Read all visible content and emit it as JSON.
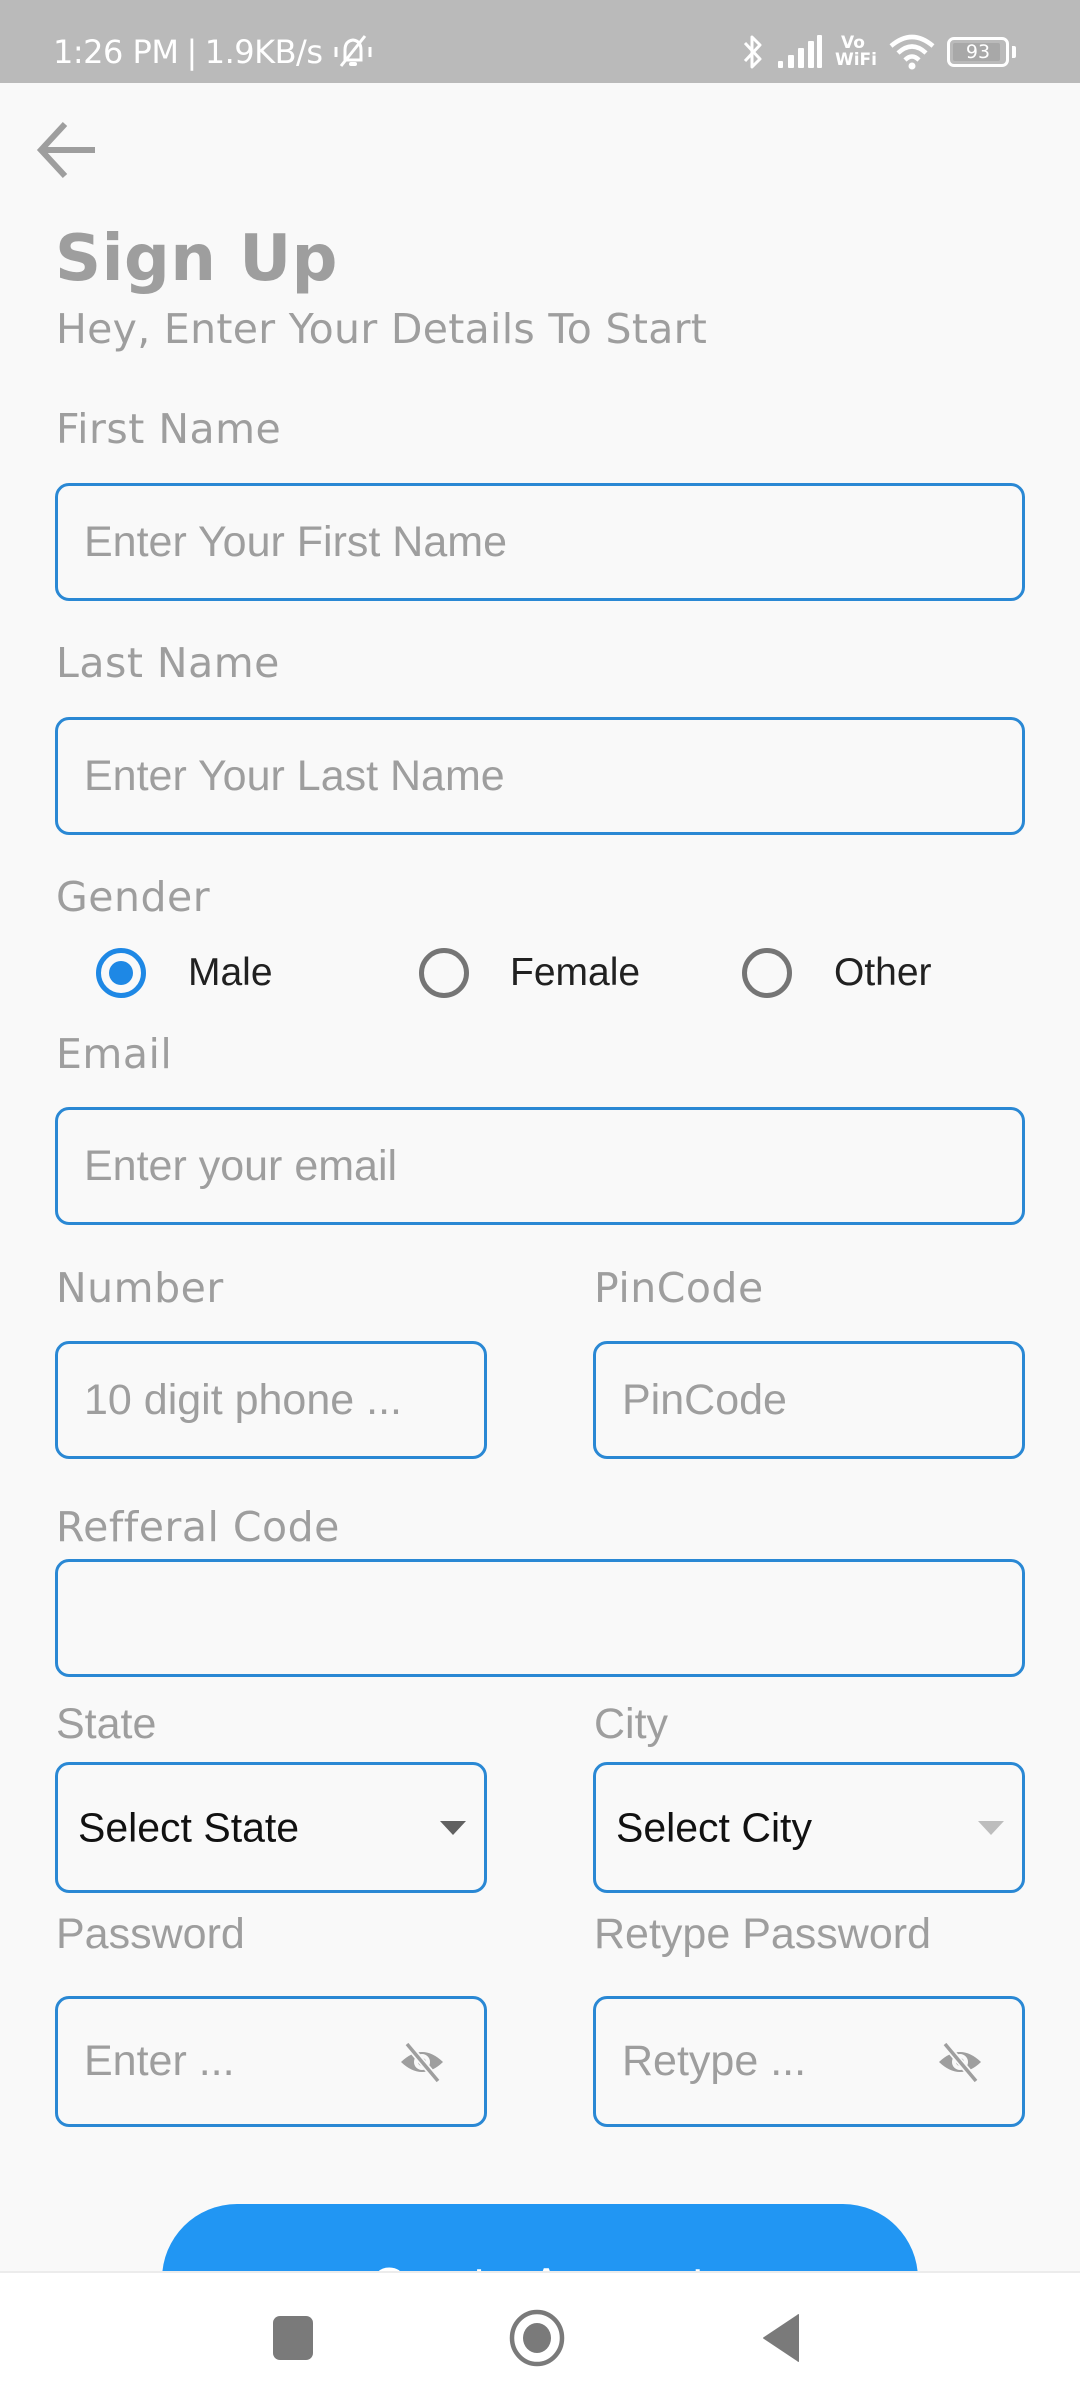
{
  "status_bar": {
    "time": "1:26 PM",
    "separator": "|",
    "network_speed": "1.9KB/s",
    "icons": [
      "bell-off-icon",
      "bluetooth-icon",
      "signal-icon",
      "vowifi-icon",
      "wifi-icon",
      "battery-icon"
    ],
    "vowifi_top": "Vo",
    "vowifi_bottom": "WiFi",
    "battery_level": "93"
  },
  "header": {
    "back_icon": "arrow-left-icon",
    "title": "Sign Up",
    "subtitle": "Hey, Enter Your Details To Start"
  },
  "form": {
    "first_name": {
      "label": "First Name",
      "placeholder": "Enter Your First Name",
      "value": ""
    },
    "last_name": {
      "label": "Last Name",
      "placeholder": "Enter Your Last Name",
      "value": ""
    },
    "gender": {
      "label": "Gender",
      "options": [
        "Male",
        "Female",
        "Other"
      ],
      "selected": "Male"
    },
    "email": {
      "label": "Email",
      "placeholder": "Enter your email",
      "value": ""
    },
    "number": {
      "label": "Number",
      "placeholder": "10 digit phone ...",
      "value": ""
    },
    "pincode": {
      "label": "PinCode",
      "placeholder": "PinCode",
      "value": ""
    },
    "referral_code": {
      "label": "Refferal Code",
      "placeholder": "",
      "value": ""
    },
    "state": {
      "label": "State",
      "selected": "Select State",
      "enabled": true
    },
    "city": {
      "label": "City",
      "selected": "Select City",
      "enabled": false
    },
    "password": {
      "label": "Password",
      "placeholder": "Enter ...",
      "visibility_icon": "eye-off-icon"
    },
    "retype_password": {
      "label": "Retype Password",
      "placeholder": "Retype ...",
      "visibility_icon": "eye-off-icon"
    },
    "submit_label": "Create Account"
  },
  "colors": {
    "accent": "#2196f3",
    "field_border": "#2a88d4",
    "radio_selected": "#1e88e5",
    "muted_text": "#9e9e9e",
    "status_bar": "#bababa"
  },
  "nav_bar": {
    "buttons": [
      "recents-icon",
      "home-icon",
      "back-icon"
    ]
  }
}
